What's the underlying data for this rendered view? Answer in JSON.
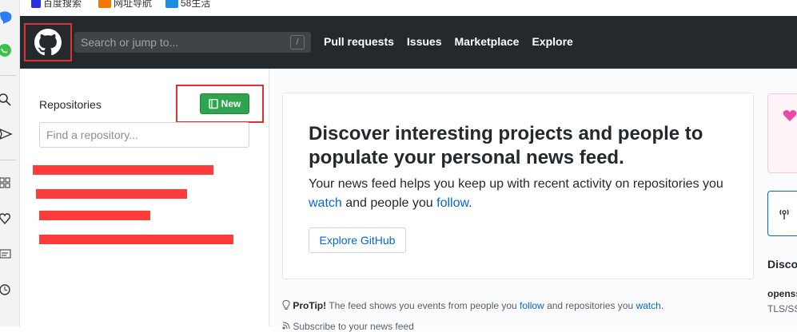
{
  "bookmarks": {
    "items": [
      {
        "label": "百度搜索",
        "icon": "paw-icon",
        "color": "#2932e1"
      },
      {
        "label": "网址导航",
        "icon": "hao-icon",
        "color": "#f07a00"
      },
      {
        "label": "58生活",
        "icon": "58-icon",
        "color": "#1c8de0"
      }
    ]
  },
  "header": {
    "search_placeholder": "Search or jump to...",
    "search_shortcut": "/",
    "nav": [
      "Pull requests",
      "Issues",
      "Marketplace",
      "Explore"
    ]
  },
  "repos": {
    "title": "Repositories",
    "new_label": "New",
    "filter_placeholder": "Find a repository..."
  },
  "feed": {
    "heading": "Discover interesting projects and people to populate your personal news feed.",
    "body_prefix": "Your news feed helps you keep up with recent activity on repositories you ",
    "watch_link": "watch",
    "body_middle": " and people you ",
    "follow_link": "follow",
    "body_suffix": ".",
    "explore_button": "Explore GitHub",
    "protip_label": "ProTip!",
    "protip_prefix": " The feed shows you events from people you ",
    "protip_follow": "follow",
    "protip_middle": " and repositories you ",
    "protip_watch": "watch",
    "protip_suffix": ".",
    "subscribe": "Subscribe to your news feed"
  },
  "right": {
    "discover": "Discov",
    "repo_name": "openss",
    "repo_desc": "TLS/SS"
  },
  "colors": {
    "header_bg": "#24292e",
    "primary_green": "#2ea44f",
    "link_blue": "#0366d6",
    "highlight_red": "#e03131",
    "redaction_red": "#ff3b3b"
  }
}
